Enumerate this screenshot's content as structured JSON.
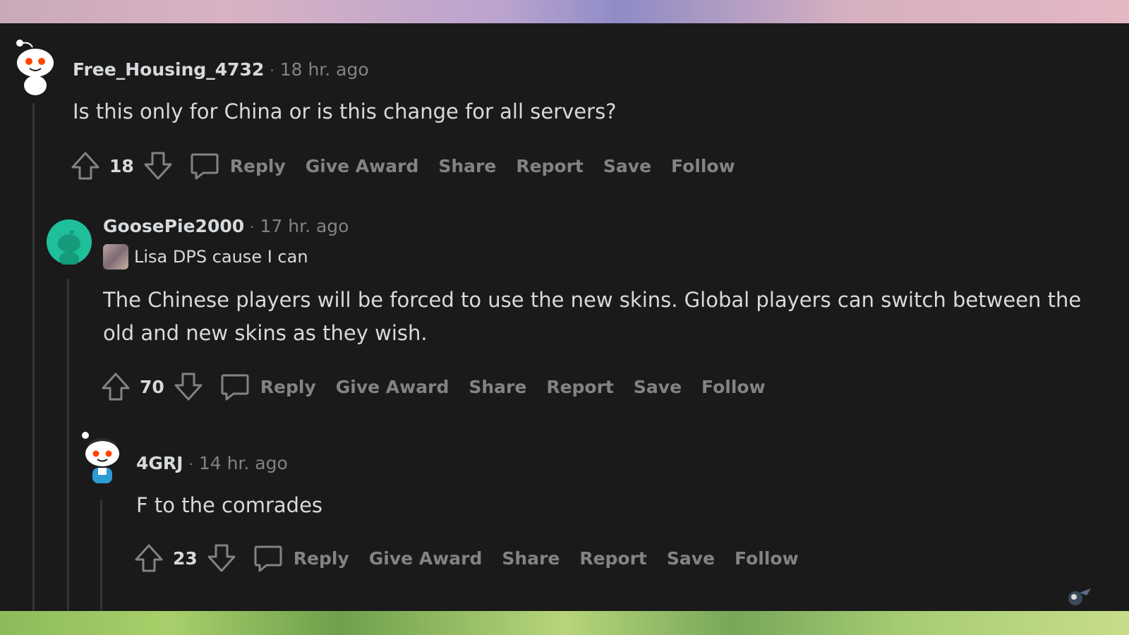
{
  "comments": [
    {
      "username": "Free_Housing_4732",
      "separator": "·",
      "time": "18 hr. ago",
      "body": "Is this only for China or is this change for all servers?",
      "score": "18",
      "actions": [
        "Reply",
        "Give Award",
        "Share",
        "Report",
        "Save",
        "Follow"
      ]
    },
    {
      "username": "GoosePie2000",
      "separator": "·",
      "time": "17 hr. ago",
      "flair": "Lisa DPS cause I can",
      "body": "The Chinese players will be forced to use the new skins. Global players can switch between the old and new skins as they wish.",
      "score": "70",
      "actions": [
        "Reply",
        "Give Award",
        "Share",
        "Report",
        "Save",
        "Follow"
      ]
    },
    {
      "username": "4GRJ",
      "separator": "·",
      "time": "14 hr. ago",
      "body": "F to the comrades",
      "score": "23",
      "actions": [
        "Reply",
        "Give Award",
        "Share",
        "Report",
        "Save",
        "Follow"
      ]
    }
  ],
  "icons": {
    "upvote": "arrow-up-icon",
    "downvote": "arrow-down-icon",
    "comment": "speech-bubble-icon"
  },
  "colors": {
    "background": "#1a1a1b",
    "text": "#d7dadc",
    "muted": "#818384",
    "avatar_green": "#1fbf9a"
  }
}
